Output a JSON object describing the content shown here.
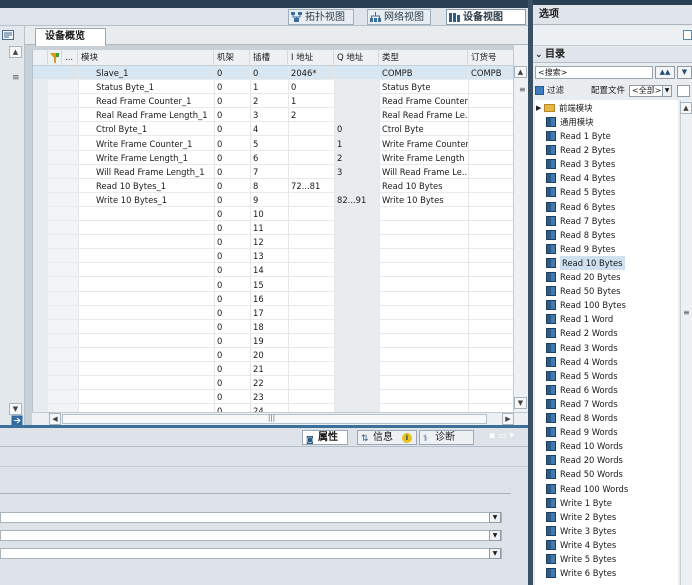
{
  "view_tabs": [
    {
      "label": "拓扑视图",
      "active": false
    },
    {
      "label": "网络视图",
      "active": false
    },
    {
      "label": "设备视图",
      "active": true
    }
  ],
  "overview_tab": "设备概览",
  "grid": {
    "headers": [
      "模块",
      "机架",
      "插槽",
      "I 地址",
      "Q 地址",
      "类型",
      "订货号"
    ],
    "rows": [
      {
        "module": "Slave_1",
        "rack": "0",
        "slot": "0",
        "i_addr": "2046*",
        "q_addr": "",
        "type": "COMPB",
        "order": "COMPB"
      },
      {
        "module": "Status Byte_1",
        "rack": "0",
        "slot": "1",
        "i_addr": "0",
        "q_addr": "",
        "type": "Status Byte",
        "order": ""
      },
      {
        "module": "Read Frame Counter_1",
        "rack": "0",
        "slot": "2",
        "i_addr": "1",
        "q_addr": "",
        "type": "Read Frame Counter",
        "order": ""
      },
      {
        "module": "Real Read Frame Length_1",
        "rack": "0",
        "slot": "3",
        "i_addr": "2",
        "q_addr": "",
        "type": "Real Read Frame Le..",
        "order": ""
      },
      {
        "module": "Ctrol Byte_1",
        "rack": "0",
        "slot": "4",
        "i_addr": "",
        "q_addr": "0",
        "type": "Ctrol Byte",
        "order": ""
      },
      {
        "module": "Write Frame Counter_1",
        "rack": "0",
        "slot": "5",
        "i_addr": "",
        "q_addr": "1",
        "type": "Write Frame Counter",
        "order": ""
      },
      {
        "module": "Write Frame Length_1",
        "rack": "0",
        "slot": "6",
        "i_addr": "",
        "q_addr": "2",
        "type": "Write Frame Length",
        "order": ""
      },
      {
        "module": "Will Read Frame Length_1",
        "rack": "0",
        "slot": "7",
        "i_addr": "",
        "q_addr": "3",
        "type": "Will Read Frame Le..",
        "order": ""
      },
      {
        "module": "Read 10 Bytes_1",
        "rack": "0",
        "slot": "8",
        "i_addr": "72...81",
        "q_addr": "",
        "type": "Read 10 Bytes",
        "order": ""
      },
      {
        "module": "Write 10 Bytes_1",
        "rack": "0",
        "slot": "9",
        "i_addr": "",
        "q_addr": "82...91",
        "type": "Write 10 Bytes",
        "order": ""
      },
      {
        "module": "",
        "rack": "0",
        "slot": "10",
        "i_addr": "",
        "q_addr": "",
        "type": "",
        "order": ""
      },
      {
        "module": "",
        "rack": "0",
        "slot": "11",
        "i_addr": "",
        "q_addr": "",
        "type": "",
        "order": ""
      },
      {
        "module": "",
        "rack": "0",
        "slot": "12",
        "i_addr": "",
        "q_addr": "",
        "type": "",
        "order": ""
      },
      {
        "module": "",
        "rack": "0",
        "slot": "13",
        "i_addr": "",
        "q_addr": "",
        "type": "",
        "order": ""
      },
      {
        "module": "",
        "rack": "0",
        "slot": "14",
        "i_addr": "",
        "q_addr": "",
        "type": "",
        "order": ""
      },
      {
        "module": "",
        "rack": "0",
        "slot": "15",
        "i_addr": "",
        "q_addr": "",
        "type": "",
        "order": ""
      },
      {
        "module": "",
        "rack": "0",
        "slot": "16",
        "i_addr": "",
        "q_addr": "",
        "type": "",
        "order": ""
      },
      {
        "module": "",
        "rack": "0",
        "slot": "17",
        "i_addr": "",
        "q_addr": "",
        "type": "",
        "order": ""
      },
      {
        "module": "",
        "rack": "0",
        "slot": "18",
        "i_addr": "",
        "q_addr": "",
        "type": "",
        "order": ""
      },
      {
        "module": "",
        "rack": "0",
        "slot": "19",
        "i_addr": "",
        "q_addr": "",
        "type": "",
        "order": ""
      },
      {
        "module": "",
        "rack": "0",
        "slot": "20",
        "i_addr": "",
        "q_addr": "",
        "type": "",
        "order": ""
      },
      {
        "module": "",
        "rack": "0",
        "slot": "21",
        "i_addr": "",
        "q_addr": "",
        "type": "",
        "order": ""
      },
      {
        "module": "",
        "rack": "0",
        "slot": "22",
        "i_addr": "",
        "q_addr": "",
        "type": "",
        "order": ""
      },
      {
        "module": "",
        "rack": "0",
        "slot": "23",
        "i_addr": "",
        "q_addr": "",
        "type": "",
        "order": ""
      },
      {
        "module": "",
        "rack": "0",
        "slot": "24",
        "i_addr": "",
        "q_addr": "",
        "type": "",
        "order": ""
      }
    ]
  },
  "bottom_tabs": [
    {
      "label": "属性",
      "active": true
    },
    {
      "label": "信息",
      "active": false
    },
    {
      "label": "诊断",
      "active": false
    }
  ],
  "right_panel": {
    "title": "选项",
    "catalog_header": "目录",
    "search_placeholder": "<搜索>",
    "filter_label": "过滤",
    "profile_label": "配置文件",
    "profile_value": "<全部>",
    "folders": [
      "前端模块",
      "通用模块"
    ],
    "items": [
      "Read 1 Byte",
      "Read 2 Bytes",
      "Read 3 Bytes",
      "Read 4 Bytes",
      "Read 5 Bytes",
      "Read 6 Bytes",
      "Read 7 Bytes",
      "Read 8 Bytes",
      "Read 9 Bytes",
      "Read 10 Bytes",
      "Read 20 Bytes",
      "Read 50 Bytes",
      "Read 100 Bytes",
      "Read 1 Word",
      "Read 2 Words",
      "Read 3 Words",
      "Read 4 Words",
      "Read 5 Words",
      "Read 6 Words",
      "Read 7 Words",
      "Read 8 Words",
      "Read 9 Words",
      "Read 10 Words",
      "Read 20 Words",
      "Read 50 Words",
      "Read 100 Words",
      "Write 1 Byte",
      "Write 2 Bytes",
      "Write 3 Bytes",
      "Write 4 Bytes",
      "Write 5 Bytes",
      "Write 6 Bytes"
    ],
    "selected_item": "Read 10 Bytes"
  }
}
